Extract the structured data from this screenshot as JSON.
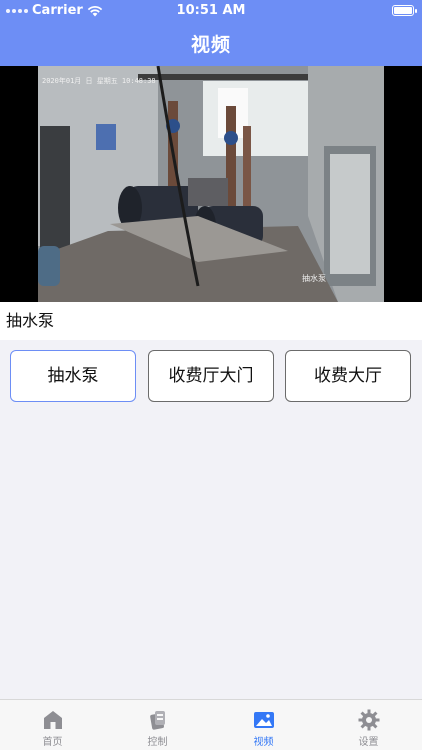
{
  "status_bar": {
    "carrier": "Carrier",
    "time": "10:51 AM"
  },
  "nav": {
    "title": "视频"
  },
  "video": {
    "overlay_timestamp": "2020年01月 日 星期五 10:48:38",
    "overlay_channel": "抽水泵"
  },
  "camera_label": "抽水泵",
  "buttons": [
    {
      "label": "抽水泵",
      "selected": true
    },
    {
      "label": "收费厅大门",
      "selected": false
    },
    {
      "label": "收费大厅",
      "selected": false
    }
  ],
  "tabs": [
    {
      "label": "首页",
      "icon": "home-icon"
    },
    {
      "label": "控制",
      "icon": "control-icon"
    },
    {
      "label": "视频",
      "icon": "video-icon",
      "active": true
    },
    {
      "label": "设置",
      "icon": "settings-icon"
    }
  ],
  "colors": {
    "accent": "#6d8ef5",
    "tab_active": "#3478f6",
    "tab_inactive": "#8e8e93"
  }
}
